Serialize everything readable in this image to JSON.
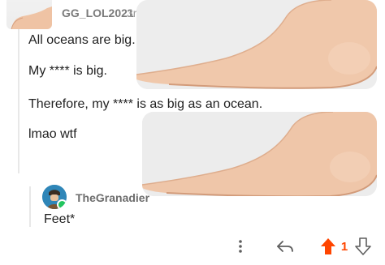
{
  "parent": {
    "username": "GG_LOL2021",
    "age": "3r",
    "lines": [
      "All oceans are big.",
      "My **** is big.",
      "Therefore, my **** is as big as an ocean.",
      "lmao wtf"
    ]
  },
  "reply": {
    "username": "TheGranadier",
    "text": "Feet*"
  },
  "actions": {
    "score": "1",
    "upvote_color": "#ff4500",
    "more_icon": "more-vertical-icon",
    "reply_icon": "reply-arrow-icon",
    "upvote_icon": "upvote-arrow-icon",
    "downvote_icon": "downvote-arrow-icon"
  }
}
